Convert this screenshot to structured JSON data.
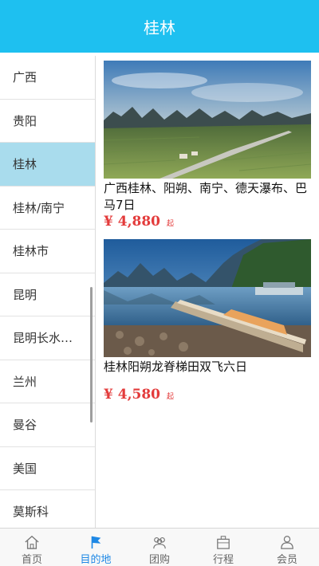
{
  "header": {
    "title": "桂林"
  },
  "sidebar": {
    "items": [
      {
        "label": "广西"
      },
      {
        "label": "贵阳"
      },
      {
        "label": "桂林"
      },
      {
        "label": "桂林/南宁"
      },
      {
        "label": "桂林市"
      },
      {
        "label": "昆明"
      },
      {
        "label": "昆明长水…"
      },
      {
        "label": "兰州"
      },
      {
        "label": "曼谷"
      },
      {
        "label": "美国"
      },
      {
        "label": "莫斯科"
      }
    ],
    "active_index": 2
  },
  "products": [
    {
      "title": "广西桂林、阳朔、南宁、德天瀑布、巴马7日",
      "price": "¥ 4,880",
      "price_suffix": "起",
      "image_icon": "karst-landscape-photo"
    },
    {
      "title": "桂林阳朔龙脊梯田双飞六日",
      "price": "¥ 4,580",
      "price_suffix": "起",
      "image_icon": "li-river-raft-photo"
    }
  ],
  "tabbar": {
    "tabs": [
      {
        "label": "首页",
        "icon": "home-icon"
      },
      {
        "label": "目的地",
        "icon": "flag-icon"
      },
      {
        "label": "团购",
        "icon": "group-icon"
      },
      {
        "label": "行程",
        "icon": "suitcase-icon"
      },
      {
        "label": "会员",
        "icon": "user-icon"
      }
    ],
    "active_index": 1
  },
  "colors": {
    "header": "#1ec0f0",
    "active_sidebar": "#a9dced",
    "price": "#e33b3b",
    "active_tab": "#1e88e5"
  }
}
